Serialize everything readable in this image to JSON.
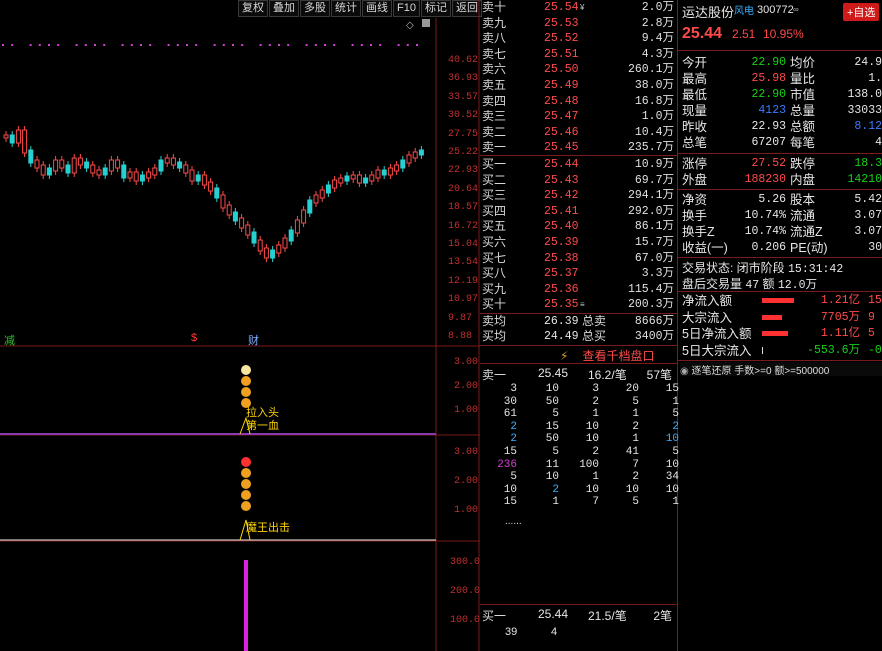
{
  "toolbar": [
    "复权",
    "叠加",
    "多股",
    "统计",
    "画线",
    "F10",
    "标记",
    "返回"
  ],
  "chart": {
    "price_axis": [
      "40.62",
      "36.93",
      "33.57",
      "30.52",
      "27.75",
      "25.22",
      "22.93",
      "20.64",
      "18.57",
      "16.72",
      "15.04",
      "13.54",
      "12.19",
      "10.97",
      "9.87",
      "8.88"
    ],
    "markers": {
      "jian": "减",
      "dollar": "$",
      "cai": "财"
    },
    "ind1_axis": [
      "3.00",
      "2.00",
      "1.00"
    ],
    "ind1_text": [
      "拉入头",
      "第一血"
    ],
    "ind2_axis": [
      "3.00",
      "2.00",
      "1.00"
    ],
    "ind2_text": "魔王出击",
    "vol_axis": [
      "300.0",
      "200.0",
      "100.0"
    ]
  },
  "orderbook": {
    "asks": [
      {
        "label": "卖十",
        "price": "25.54",
        "vol": "2.0万",
        "flag": "¥"
      },
      {
        "label": "卖九",
        "price": "25.53",
        "vol": "2.8万",
        "flag": ""
      },
      {
        "label": "卖八",
        "price": "25.52",
        "vol": "9.4万",
        "flag": ""
      },
      {
        "label": "卖七",
        "price": "25.51",
        "vol": "4.3万",
        "flag": ""
      },
      {
        "label": "卖六",
        "price": "25.50",
        "vol": "260.1万",
        "flag": ""
      },
      {
        "label": "卖五",
        "price": "25.49",
        "vol": "38.0万",
        "flag": ""
      },
      {
        "label": "卖四",
        "price": "25.48",
        "vol": "16.8万",
        "flag": ""
      },
      {
        "label": "卖三",
        "price": "25.47",
        "vol": "1.0万",
        "flag": ""
      },
      {
        "label": "卖二",
        "price": "25.46",
        "vol": "10.4万",
        "flag": ""
      },
      {
        "label": "卖一",
        "price": "25.45",
        "vol": "235.7万",
        "flag": ""
      }
    ],
    "bids": [
      {
        "label": "买一",
        "price": "25.44",
        "vol": "10.9万",
        "flag": ""
      },
      {
        "label": "买二",
        "price": "25.43",
        "vol": "69.7万",
        "flag": ""
      },
      {
        "label": "买三",
        "price": "25.42",
        "vol": "294.1万",
        "flag": ""
      },
      {
        "label": "买四",
        "price": "25.41",
        "vol": "292.0万",
        "flag": ""
      },
      {
        "label": "买五",
        "price": "25.40",
        "vol": "86.1万",
        "flag": ""
      },
      {
        "label": "买六",
        "price": "25.39",
        "vol": "15.7万",
        "flag": ""
      },
      {
        "label": "买七",
        "price": "25.38",
        "vol": "67.0万",
        "flag": ""
      },
      {
        "label": "买八",
        "price": "25.37",
        "vol": "3.3万",
        "flag": ""
      },
      {
        "label": "买九",
        "price": "25.36",
        "vol": "115.4万",
        "flag": ""
      },
      {
        "label": "买十",
        "price": "25.35",
        "vol": "200.3万",
        "flag": "≡"
      }
    ],
    "sell_avg": {
      "label": "卖均",
      "price": "26.39",
      "tlabel": "总卖",
      "vol": "8666万"
    },
    "buy_avg": {
      "label": "买均",
      "price": "24.49",
      "tlabel": "总买",
      "vol": "3400万"
    },
    "view_more": "查看千档盘口",
    "queue_sell": {
      "label": "卖一",
      "price": "25.45",
      "per": "16.2/笔",
      "count": "57笔"
    },
    "queue_grid": [
      [
        "3",
        "10",
        "3",
        "20",
        "15"
      ],
      [
        "30",
        "50",
        "2",
        "5",
        "1"
      ],
      [
        "61",
        "5",
        "1",
        "1",
        "5"
      ],
      [
        "2",
        "15",
        "10",
        "2",
        "2"
      ],
      [
        "2",
        "50",
        "10",
        "1",
        "10"
      ],
      [
        "15",
        "5",
        "2",
        "41",
        "5"
      ],
      [
        "236",
        "11",
        "100",
        "7",
        "10"
      ],
      [
        "5",
        "10",
        "1",
        "2",
        "34"
      ],
      [
        "10",
        "2",
        "10",
        "10",
        "10"
      ],
      [
        "15",
        "1",
        "7",
        "5",
        "1"
      ]
    ],
    "queue_more": "......",
    "queue_buy": {
      "label": "买一",
      "price": "25.44",
      "per": "21.5/笔",
      "count": "2笔"
    },
    "queue_buy_grid": [
      "39",
      "4"
    ]
  },
  "quote": {
    "name": "运达股份",
    "tag": "风电",
    "code": "300772",
    "add_btn": "+自选",
    "price": "25.44",
    "change": "2.51",
    "pct": "10.95%",
    "rows": [
      [
        "今开",
        "22.90",
        "均价",
        "24.9"
      ],
      [
        "最高",
        "25.98",
        "量比",
        "1."
      ],
      [
        "最低",
        "22.90",
        "市值",
        "138.0"
      ],
      [
        "现量",
        "4123",
        "总量",
        "33033"
      ],
      [
        "昨收",
        "22.93",
        "总额",
        "8.12"
      ],
      [
        "总笔",
        "67207",
        "每笔",
        "4"
      ],
      [
        "涨停",
        "27.52",
        "跌停",
        "18.3"
      ],
      [
        "外盘",
        "188230",
        "内盘",
        "14210"
      ],
      [
        "净资",
        "5.26",
        "股本",
        "5.42"
      ],
      [
        "换手",
        "10.74%",
        "流通",
        "3.07"
      ],
      [
        "换手Z",
        "10.74%",
        "流通Z",
        "3.07"
      ],
      [
        "收益(一)",
        "0.206",
        "PE(动)",
        "30"
      ]
    ],
    "status_label": "交易状态: 闭市阶段",
    "status_time": "15:31:42",
    "after_label": "盘后交易量",
    "after_vol": "47",
    "after_amt_label": "额",
    "after_amt": "12.0万",
    "flows": [
      {
        "label": "净流入额",
        "value": "1.21亿",
        "extra": "15"
      },
      {
        "label": "大宗流入",
        "value": "7705万",
        "extra": "9"
      },
      {
        "label": "5日净流入额",
        "value": "1.11亿",
        "extra": "5"
      },
      {
        "label": "5日大宗流入",
        "value": "-553.6万",
        "extra": "-0"
      }
    ],
    "trade_filter": "逐笔还原  手数>=0 额>=500000"
  },
  "colors": {
    "up": "#ff4a4a",
    "down": "#16d116",
    "bg": "#000000",
    "grid": "#7a1a1a"
  }
}
